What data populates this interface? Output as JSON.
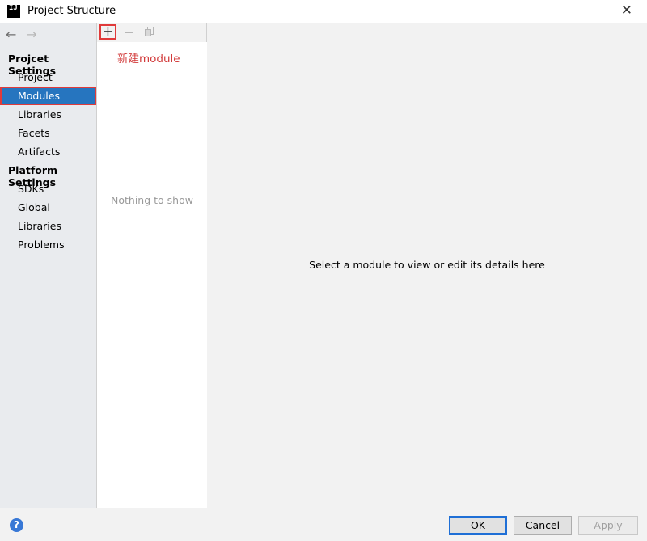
{
  "window": {
    "title": "Project Structure",
    "app_icon_text": "IJ",
    "close_glyph": "✕"
  },
  "sidebar": {
    "back_glyph": "←",
    "forward_glyph": "→",
    "project_settings_title": "Projcet Settings",
    "platform_settings_title": "Platform Settings",
    "items": [
      {
        "label": "Project"
      },
      {
        "label": "Modules",
        "selected": true
      },
      {
        "label": "Libraries"
      },
      {
        "label": "Facets"
      },
      {
        "label": "Artifacts"
      },
      {
        "label": "SDKs"
      },
      {
        "label": "Global Libraries"
      },
      {
        "label": "Problems"
      }
    ]
  },
  "list_panel": {
    "add_glyph": "+",
    "remove_glyph": "−",
    "annotation": "新建module",
    "empty_text": "Nothing to show"
  },
  "detail": {
    "placeholder": "Select a module to view or edit its details here"
  },
  "footer": {
    "help_glyph": "?",
    "ok_label": "OK",
    "cancel_label": "Cancel",
    "apply_label": "Apply"
  },
  "colors": {
    "selection": "#2675bf",
    "annotation_red": "#e03a3a",
    "help_blue": "#3878d6"
  }
}
